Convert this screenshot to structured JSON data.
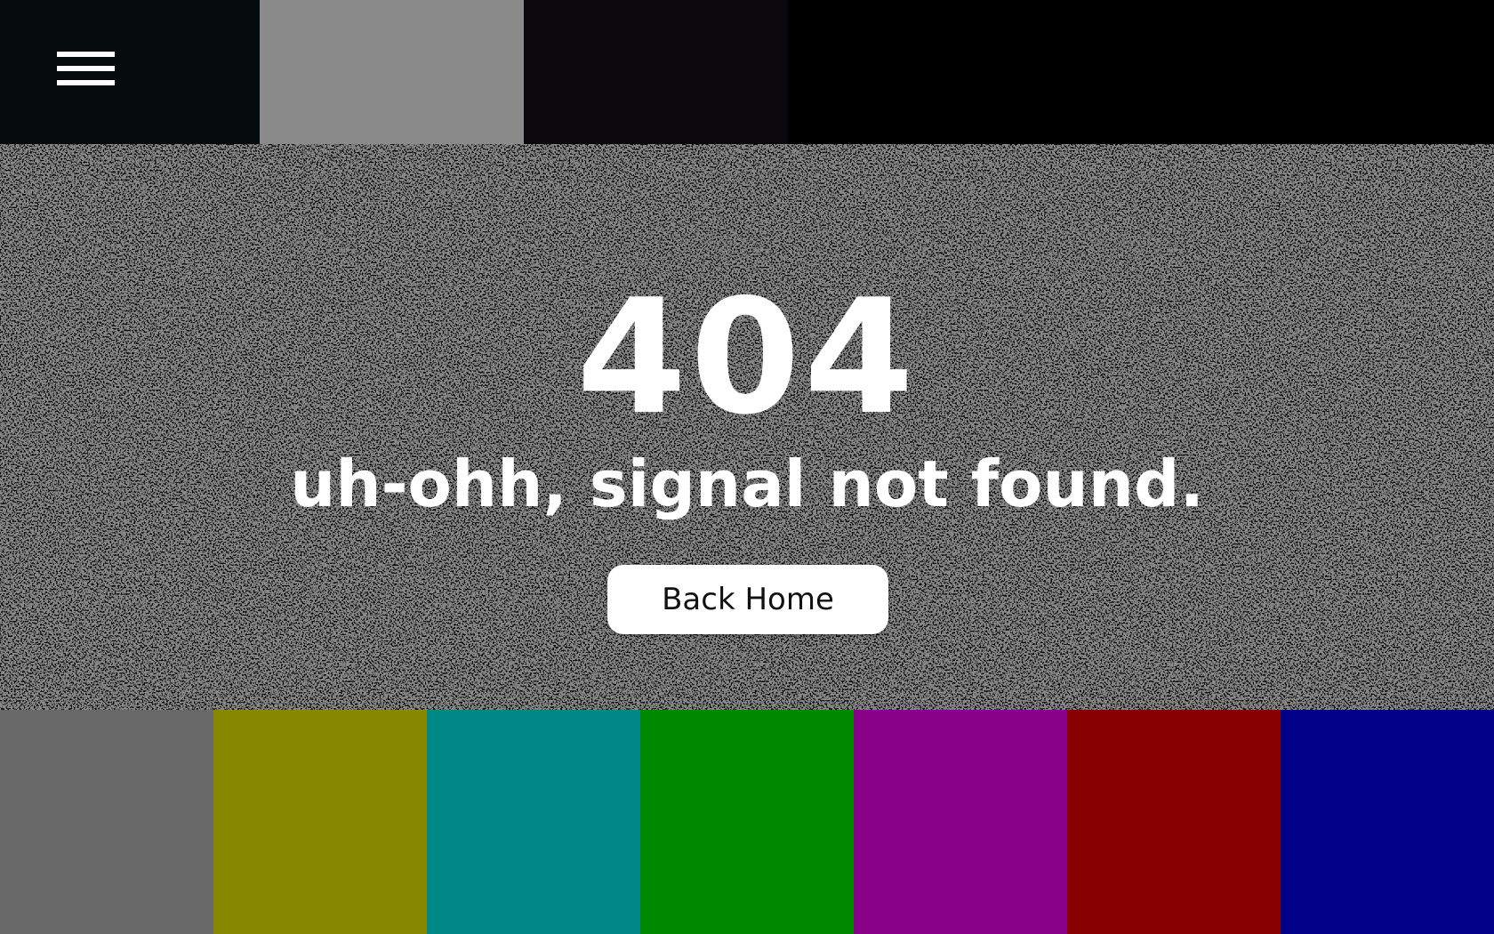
{
  "top_bar": {
    "blocks": [
      {
        "color": "#050a0c"
      },
      {
        "color": "#8a8a8a"
      },
      {
        "color": "#0a080c"
      },
      {
        "color": "#000000"
      }
    ],
    "menu_icon": "hamburger-menu-icon"
  },
  "error": {
    "code": "404",
    "message": "uh-ohh, signal not found.",
    "button_label": "Back Home"
  },
  "noise": {
    "base_color": "#8a8a8a",
    "dark_color": "#0c0c0c"
  },
  "color_bars": [
    {
      "name": "gray",
      "color": "#686868"
    },
    {
      "name": "olive",
      "color": "#888800"
    },
    {
      "name": "teal",
      "color": "#008888"
    },
    {
      "name": "green",
      "color": "#008800"
    },
    {
      "name": "purple",
      "color": "#880088"
    },
    {
      "name": "maroon",
      "color": "#880000"
    },
    {
      "name": "navy",
      "color": "#000088"
    }
  ]
}
